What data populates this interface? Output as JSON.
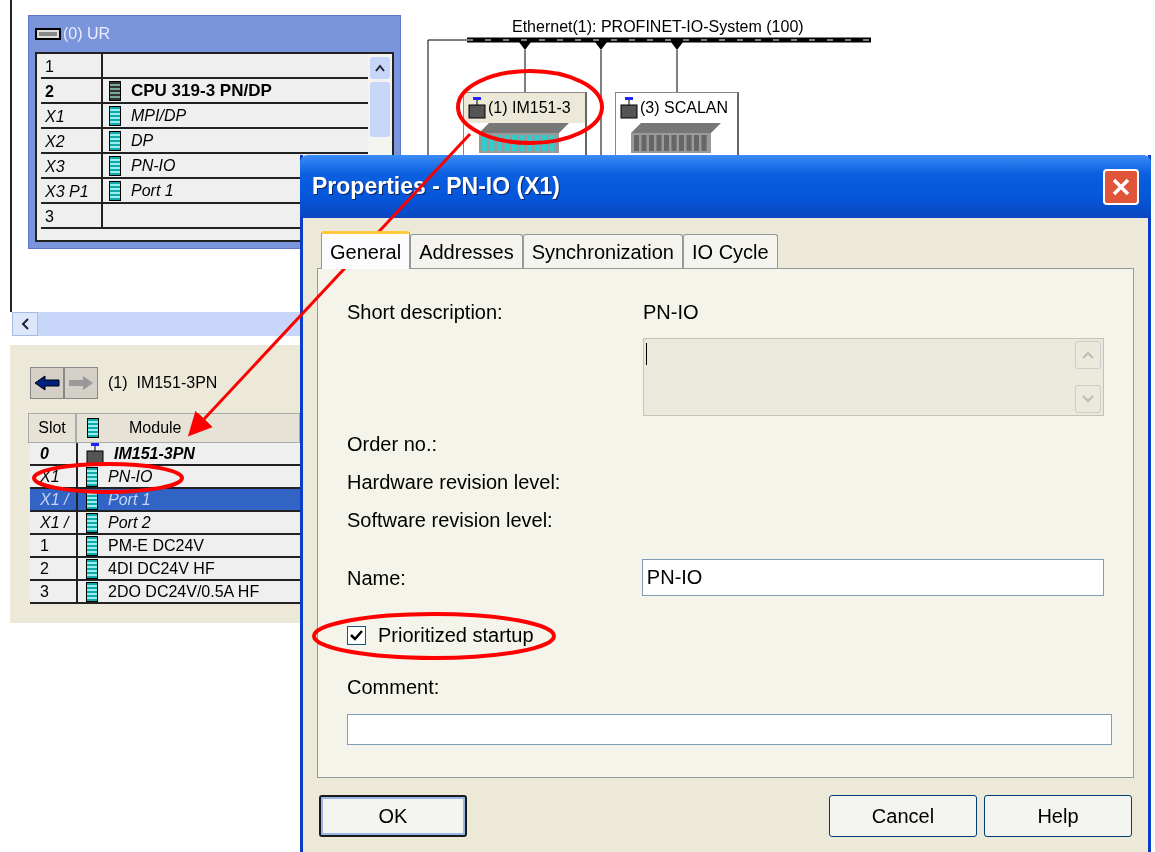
{
  "rack": {
    "title": "(0) UR",
    "rows": [
      {
        "slot": "1",
        "module": "",
        "kind": "empty"
      },
      {
        "slot": "2",
        "module": "CPU 319-3 PN/DP",
        "kind": "module"
      },
      {
        "slot": "X1",
        "module": "MPI/DP",
        "kind": "submodule"
      },
      {
        "slot": "X2",
        "module": "DP",
        "kind": "submodule"
      },
      {
        "slot": "X3",
        "module": "PN-IO",
        "kind": "submodule"
      },
      {
        "slot": "X3 P1",
        "module": "Port 1",
        "kind": "submodule"
      },
      {
        "slot": "3",
        "module": "",
        "kind": "empty"
      }
    ]
  },
  "network": {
    "label": "Ethernet(1): PROFINET-IO-System (100)",
    "devices": [
      {
        "name": "(1) IM151-3",
        "kind": "et200"
      },
      {
        "name": "(3) SCALAN",
        "kind": "switch"
      }
    ]
  },
  "detail": {
    "title": "(1)  IM151-3PN",
    "columns": [
      "Slot",
      "Module"
    ],
    "rows": [
      {
        "slot": "0",
        "module": "IM151-3PN",
        "kind": "head",
        "selected": false
      },
      {
        "slot": "X1",
        "module": "PN-IO",
        "kind": "submodule",
        "selected": false
      },
      {
        "slot": "X1 /",
        "module": "Port 1",
        "kind": "submodule",
        "selected": true
      },
      {
        "slot": "X1 /",
        "module": "Port 2",
        "kind": "submodule",
        "selected": false
      },
      {
        "slot": "1",
        "module": "PM-E DC24V",
        "kind": "module",
        "selected": false
      },
      {
        "slot": "2",
        "module": "4DI DC24V HF",
        "kind": "module",
        "selected": false
      },
      {
        "slot": "3",
        "module": "2DO DC24V/0.5A HF",
        "kind": "module",
        "selected": false
      }
    ]
  },
  "dialog": {
    "title": "Properties - PN-IO (X1)",
    "tabs": [
      {
        "label": "General",
        "selected": true
      },
      {
        "label": "Addresses",
        "selected": false
      },
      {
        "label": "Synchronization",
        "selected": false
      },
      {
        "label": "IO Cycle",
        "selected": false
      }
    ],
    "short_description": {
      "label": "Short description:",
      "value": "PN-IO"
    },
    "info_labels": [
      "Order no.:",
      "Hardware revision level:",
      "Software revision level:"
    ],
    "name": {
      "label": "Name:",
      "value": "PN-IO"
    },
    "prioritized_startup": {
      "label": "Prioritized startup",
      "checked": true
    },
    "comment": {
      "label": "Comment:"
    },
    "buttons": [
      {
        "label": "OK",
        "focused": true
      },
      {
        "label": "Cancel",
        "focused": false
      },
      {
        "label": "Help",
        "focused": false
      }
    ]
  }
}
